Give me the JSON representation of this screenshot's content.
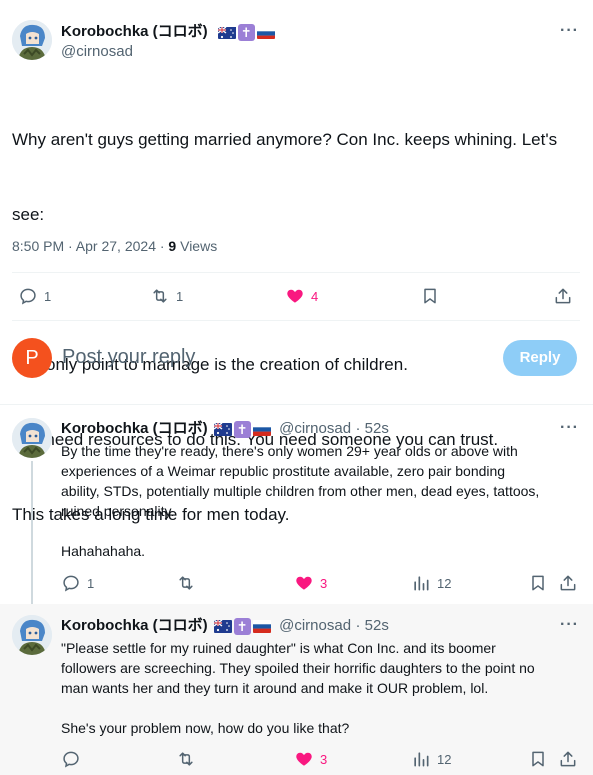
{
  "main_tweet": {
    "display_name": "Korobochka (コロボ)",
    "handle": "@cirnosad",
    "more_icon": "more-horizontal-icon",
    "text_lines": [
      "Why aren't guys getting married anymore? Con Inc. keeps whining. Let's",
      "see:",
      "",
      "The only point to marriage is the creation of children.",
      "You need resources to do this. You need someone you can trust.",
      "This takes a long time for men today."
    ],
    "timestamp": "8:50 PM · Apr 27, 2024 · ",
    "views_count": "9",
    "views_label": " Views",
    "actions": {
      "reply_count": "1",
      "retweet_count": "1",
      "like_count": "4"
    }
  },
  "composer": {
    "avatar_letter": "P",
    "placeholder": "Post your reply",
    "button_label": "Reply"
  },
  "replies": [
    {
      "display_name": "Korobochka (コロボ)",
      "handle": "@cirnosad",
      "age": "· 52s",
      "text": "By the time they're ready, there's only women 29+ year olds or above with\nexperiences of a Weimar republic prostitute available, zero pair bonding\nability, STDs, potentially multiple children from other men, dead eyes, tattoos,\nruined personality.\n\nHahahahaha.",
      "reply_count": "1",
      "retweet_count": "",
      "like_count": "3",
      "views_count": "12"
    },
    {
      "display_name": "Korobochka (コロボ)",
      "handle": "@cirnosad",
      "age": "· 52s",
      "text": "\"Please settle for my ruined daughter\" is what Con Inc. and its boomer\nfollowers are screeching. They spoiled their horrific daughters to the point no\nman wants her and they turn it around and make it OUR problem, lol.\n\nShe's your problem now, how do you like that?",
      "reply_count": "",
      "retweet_count": "",
      "like_count": "3",
      "views_count": "12"
    }
  ],
  "colors": {
    "like": "#f91880",
    "reply_button": "#8ecdf7",
    "badge_purple": "#9b7fd6",
    "user_avatar": "#f4511e"
  }
}
